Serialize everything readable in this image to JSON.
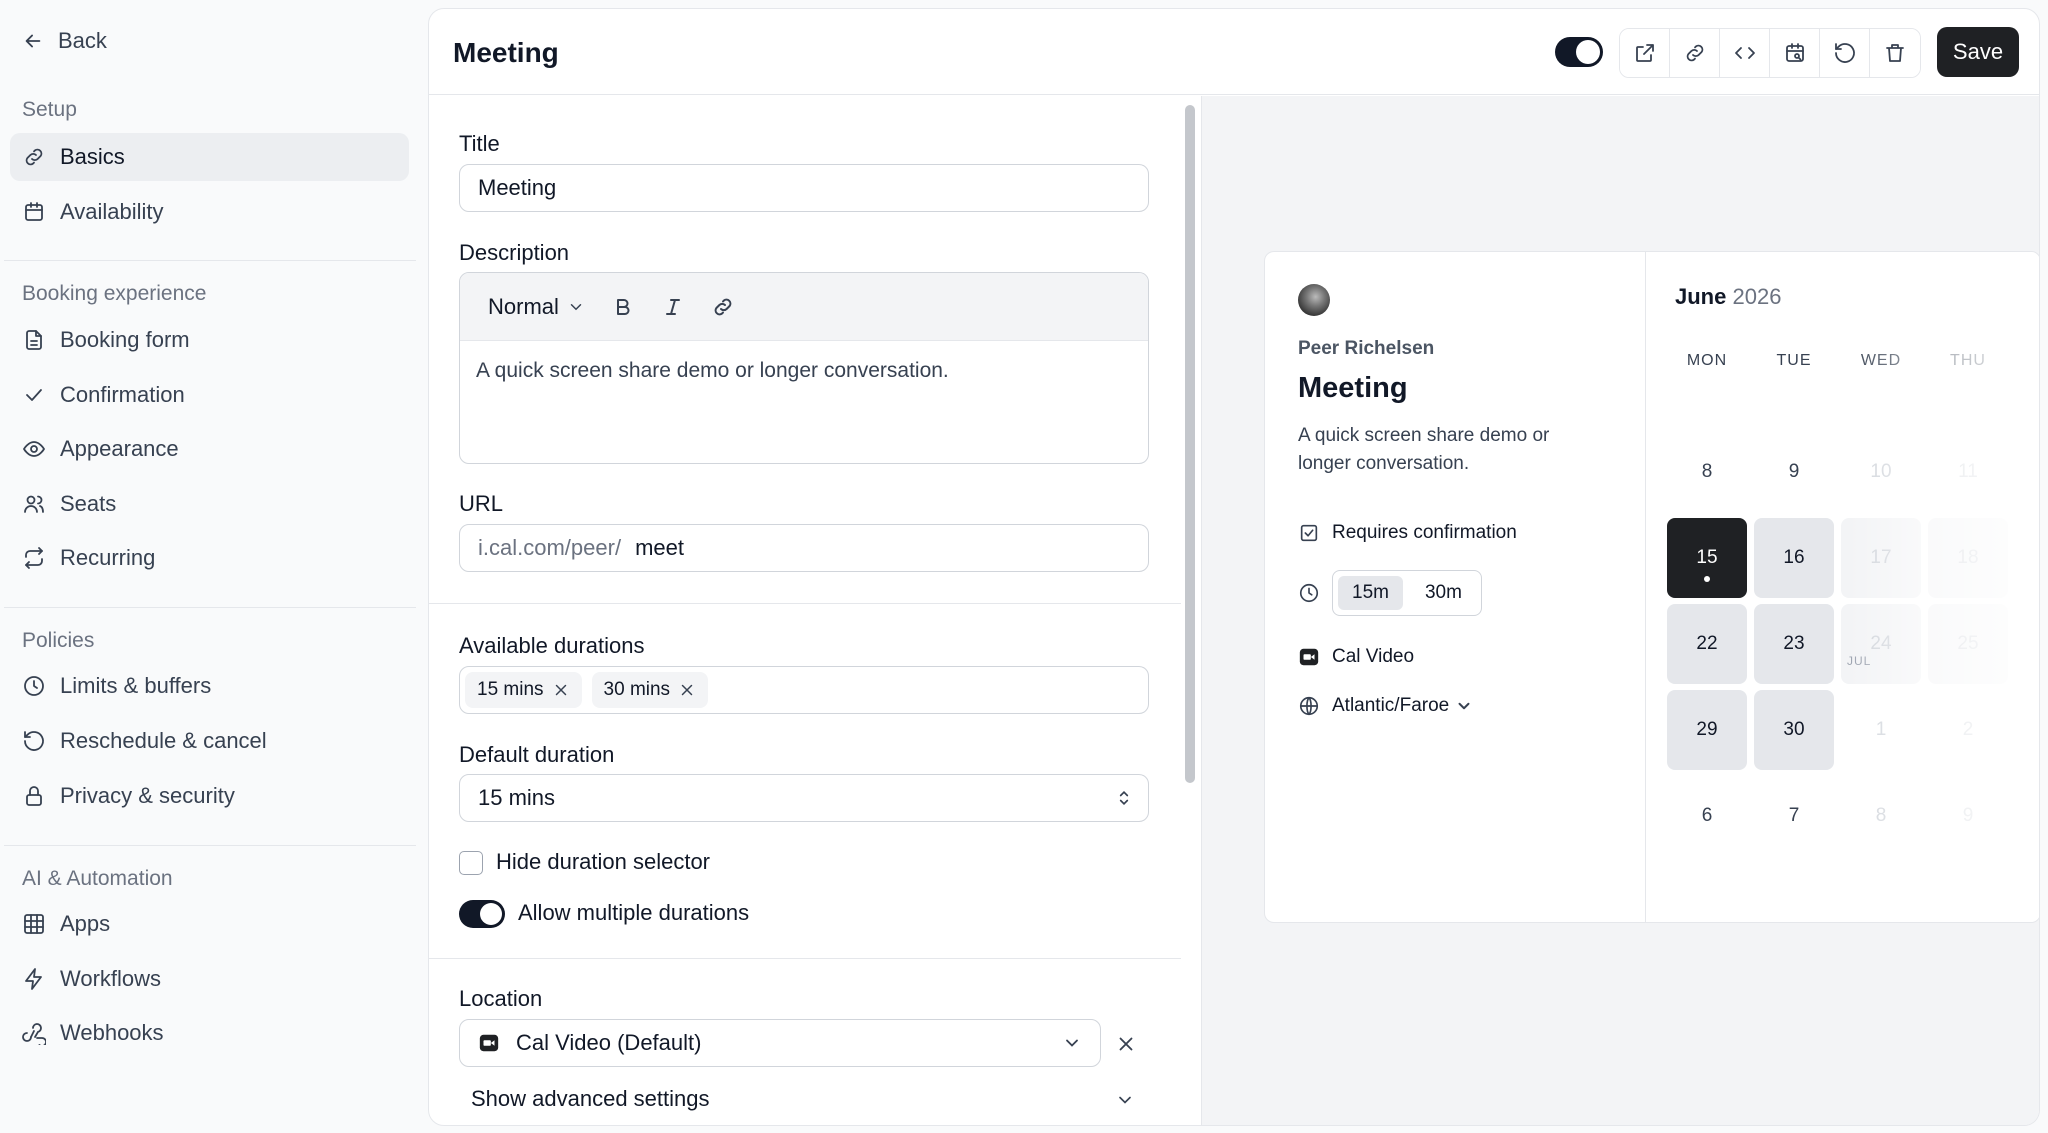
{
  "sidebar": {
    "back_label": "Back",
    "sections": [
      {
        "title": "Setup",
        "items": [
          {
            "label": "Basics",
            "icon": "link-icon",
            "active": true
          },
          {
            "label": "Availability",
            "icon": "calendar-icon"
          }
        ]
      },
      {
        "title": "Booking experience",
        "items": [
          {
            "label": "Booking form",
            "icon": "file-icon"
          },
          {
            "label": "Confirmation",
            "icon": "check-icon"
          },
          {
            "label": "Appearance",
            "icon": "eye-icon"
          },
          {
            "label": "Seats",
            "icon": "users-icon"
          },
          {
            "label": "Recurring",
            "icon": "repeat-icon"
          }
        ]
      },
      {
        "title": "Policies",
        "items": [
          {
            "label": "Limits & buffers",
            "icon": "clock-icon"
          },
          {
            "label": "Reschedule & cancel",
            "icon": "rotate-icon"
          },
          {
            "label": "Privacy & security",
            "icon": "lock-icon"
          }
        ]
      },
      {
        "title": "AI & Automation",
        "items": [
          {
            "label": "Apps",
            "icon": "grid-icon"
          },
          {
            "label": "Workflows",
            "icon": "zap-icon"
          },
          {
            "label": "Webhooks",
            "icon": "webhook-icon"
          }
        ]
      }
    ]
  },
  "header": {
    "title": "Meeting",
    "save_label": "Save",
    "toggle_on": true,
    "icons": [
      "external-link-icon",
      "link-icon",
      "code-icon",
      "calendar-search-icon",
      "undo-icon",
      "trash-icon"
    ]
  },
  "form": {
    "title_label": "Title",
    "title_value": "Meeting",
    "description_label": "Description",
    "format_value": "Normal",
    "description_value": "A quick screen share demo or longer conversation.",
    "url_label": "URL",
    "url_prefix": "i.cal.com/peer/",
    "url_slug": "meet",
    "durations_label": "Available durations",
    "durations": [
      "15 mins",
      "30 mins"
    ],
    "default_duration_label": "Default duration",
    "default_duration_value": "15 mins",
    "hide_selector_label": "Hide duration selector",
    "hide_selector_checked": false,
    "allow_multiple_label": "Allow multiple durations",
    "allow_multiple_on": true,
    "location_label": "Location",
    "location_value": "Cal Video (Default)",
    "advanced_label": "Show advanced settings"
  },
  "preview": {
    "host": "Peer Richelsen",
    "title": "Meeting",
    "description": "A quick screen share demo or longer conversation.",
    "requires_confirmation": "Requires confirmation",
    "duration_options": [
      "15m",
      "30m"
    ],
    "selected_duration": "15m",
    "location": "Cal Video",
    "timezone": "Atlantic/Faroe",
    "calendar": {
      "month": "June",
      "year": "2026",
      "weekdays": [
        "MON",
        "TUE",
        "WED",
        "THU"
      ],
      "next_month_label": "JUL",
      "selected_day": "15"
    }
  },
  "colors": {
    "accent": "#1f2124",
    "available_day": "#e5e7eb",
    "preview_bg": "#f3f4f6"
  }
}
